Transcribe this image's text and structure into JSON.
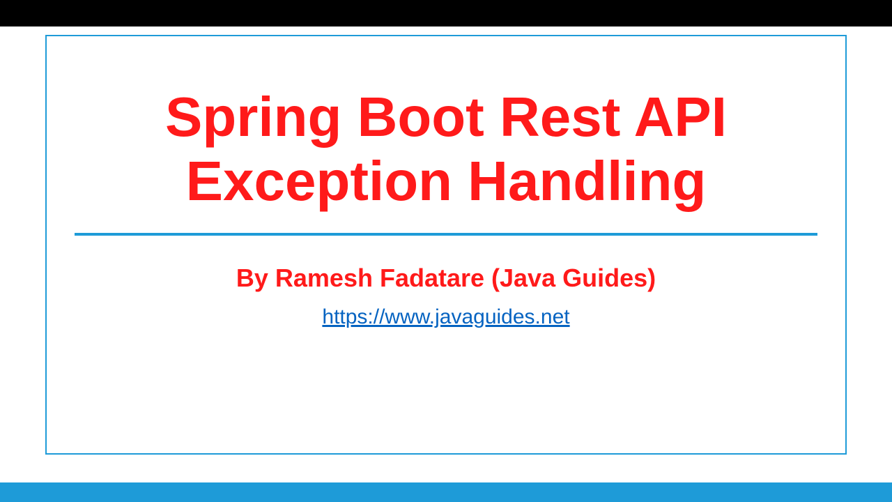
{
  "slide": {
    "title": "Spring Boot Rest API Exception Handling",
    "author": "By Ramesh Fadatare (Java Guides)",
    "link_text": "https://www.javaguides.net",
    "link_href": "https://www.javaguides.net"
  },
  "colors": {
    "title_color": "#ff1a1a",
    "accent_color": "#1e9bd8",
    "link_color": "#0563c1",
    "top_bar": "#000000"
  }
}
